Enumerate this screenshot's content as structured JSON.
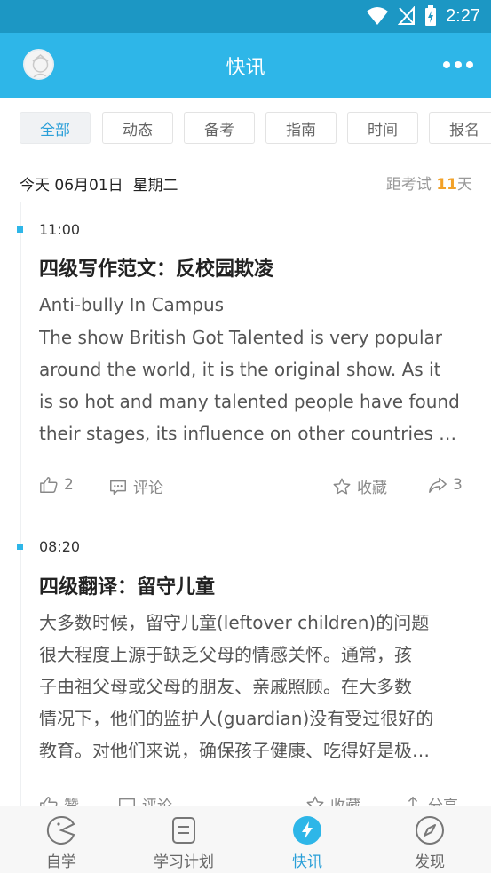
{
  "status_bar": {
    "time": "2:27"
  },
  "app_bar": {
    "title": "快讯"
  },
  "tabs": [
    {
      "label": "全部",
      "active": true
    },
    {
      "label": "动态"
    },
    {
      "label": "备考"
    },
    {
      "label": "指南"
    },
    {
      "label": "时间"
    },
    {
      "label": "报名"
    }
  ],
  "date_row": {
    "date": "今天 06月01日  星期二",
    "countdown_prefix": "距考试",
    "countdown_days": "11",
    "countdown_suffix": "天"
  },
  "posts": [
    {
      "time": "11:00",
      "title": "四级写作范文：反校园欺凌",
      "subtitle": "Anti-bully In Campus",
      "body_lines": [
        "The show British Got Talented is very popular",
        "around the world, it is the original show. As it",
        "is so hot and many talented people have found",
        "their stages, its influence on other countries ca…"
      ],
      "likes": "2",
      "comment_label": "评论",
      "favorite_label": "收藏",
      "shares": "3"
    },
    {
      "time": "08:20",
      "title": "四级翻译：留守儿童",
      "body_lines": [
        "大多数时候，留守儿童(leftover children)的问题",
        "很大程度上源于缺乏父母的情感关怀。通常，孩",
        "子由祖父母或父母的朋友、亲戚照顾。在大多数",
        "情况下，他们的监护人(guardian)没有受过很好的",
        "教育。对他们来说，确保孩子健康、吃得好是极…"
      ],
      "like_label": "赞",
      "comment_label": "评论",
      "favorite_label": "收藏",
      "share_label": "分享"
    }
  ],
  "bottom_nav": [
    {
      "label": "自学",
      "icon": "pacman-icon"
    },
    {
      "label": "学习计划",
      "icon": "document-icon"
    },
    {
      "label": "快讯",
      "icon": "lightning-icon",
      "active": true
    },
    {
      "label": "发现",
      "icon": "compass-icon"
    }
  ],
  "colors": {
    "status_bar": "#1c97c4",
    "app_bar": "#2eb6e8",
    "accent": "#2a9fd8",
    "countdown_number": "#f2a128"
  }
}
